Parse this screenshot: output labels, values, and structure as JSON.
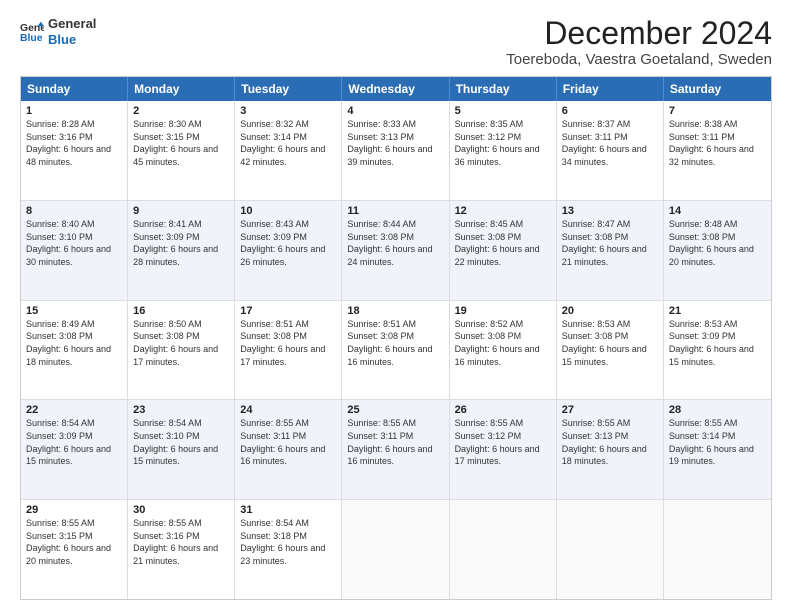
{
  "logo": {
    "line1": "General",
    "line2": "Blue"
  },
  "title": "December 2024",
  "subtitle": "Toereboda, Vaestra Goetaland, Sweden",
  "header_days": [
    "Sunday",
    "Monday",
    "Tuesday",
    "Wednesday",
    "Thursday",
    "Friday",
    "Saturday"
  ],
  "weeks": [
    {
      "alt": false,
      "days": [
        {
          "num": "1",
          "sunrise": "8:28 AM",
          "sunset": "3:16 PM",
          "daylight": "6 hours and 48 minutes."
        },
        {
          "num": "2",
          "sunrise": "8:30 AM",
          "sunset": "3:15 PM",
          "daylight": "6 hours and 45 minutes."
        },
        {
          "num": "3",
          "sunrise": "8:32 AM",
          "sunset": "3:14 PM",
          "daylight": "6 hours and 42 minutes."
        },
        {
          "num": "4",
          "sunrise": "8:33 AM",
          "sunset": "3:13 PM",
          "daylight": "6 hours and 39 minutes."
        },
        {
          "num": "5",
          "sunrise": "8:35 AM",
          "sunset": "3:12 PM",
          "daylight": "6 hours and 36 minutes."
        },
        {
          "num": "6",
          "sunrise": "8:37 AM",
          "sunset": "3:11 PM",
          "daylight": "6 hours and 34 minutes."
        },
        {
          "num": "7",
          "sunrise": "8:38 AM",
          "sunset": "3:11 PM",
          "daylight": "6 hours and 32 minutes."
        }
      ]
    },
    {
      "alt": true,
      "days": [
        {
          "num": "8",
          "sunrise": "8:40 AM",
          "sunset": "3:10 PM",
          "daylight": "6 hours and 30 minutes."
        },
        {
          "num": "9",
          "sunrise": "8:41 AM",
          "sunset": "3:09 PM",
          "daylight": "6 hours and 28 minutes."
        },
        {
          "num": "10",
          "sunrise": "8:43 AM",
          "sunset": "3:09 PM",
          "daylight": "6 hours and 26 minutes."
        },
        {
          "num": "11",
          "sunrise": "8:44 AM",
          "sunset": "3:08 PM",
          "daylight": "6 hours and 24 minutes."
        },
        {
          "num": "12",
          "sunrise": "8:45 AM",
          "sunset": "3:08 PM",
          "daylight": "6 hours and 22 minutes."
        },
        {
          "num": "13",
          "sunrise": "8:47 AM",
          "sunset": "3:08 PM",
          "daylight": "6 hours and 21 minutes."
        },
        {
          "num": "14",
          "sunrise": "8:48 AM",
          "sunset": "3:08 PM",
          "daylight": "6 hours and 20 minutes."
        }
      ]
    },
    {
      "alt": false,
      "days": [
        {
          "num": "15",
          "sunrise": "8:49 AM",
          "sunset": "3:08 PM",
          "daylight": "6 hours and 18 minutes."
        },
        {
          "num": "16",
          "sunrise": "8:50 AM",
          "sunset": "3:08 PM",
          "daylight": "6 hours and 17 minutes."
        },
        {
          "num": "17",
          "sunrise": "8:51 AM",
          "sunset": "3:08 PM",
          "daylight": "6 hours and 17 minutes."
        },
        {
          "num": "18",
          "sunrise": "8:51 AM",
          "sunset": "3:08 PM",
          "daylight": "6 hours and 16 minutes."
        },
        {
          "num": "19",
          "sunrise": "8:52 AM",
          "sunset": "3:08 PM",
          "daylight": "6 hours and 16 minutes."
        },
        {
          "num": "20",
          "sunrise": "8:53 AM",
          "sunset": "3:08 PM",
          "daylight": "6 hours and 15 minutes."
        },
        {
          "num": "21",
          "sunrise": "8:53 AM",
          "sunset": "3:09 PM",
          "daylight": "6 hours and 15 minutes."
        }
      ]
    },
    {
      "alt": true,
      "days": [
        {
          "num": "22",
          "sunrise": "8:54 AM",
          "sunset": "3:09 PM",
          "daylight": "6 hours and 15 minutes."
        },
        {
          "num": "23",
          "sunrise": "8:54 AM",
          "sunset": "3:10 PM",
          "daylight": "6 hours and 15 minutes."
        },
        {
          "num": "24",
          "sunrise": "8:55 AM",
          "sunset": "3:11 PM",
          "daylight": "6 hours and 16 minutes."
        },
        {
          "num": "25",
          "sunrise": "8:55 AM",
          "sunset": "3:11 PM",
          "daylight": "6 hours and 16 minutes."
        },
        {
          "num": "26",
          "sunrise": "8:55 AM",
          "sunset": "3:12 PM",
          "daylight": "6 hours and 17 minutes."
        },
        {
          "num": "27",
          "sunrise": "8:55 AM",
          "sunset": "3:13 PM",
          "daylight": "6 hours and 18 minutes."
        },
        {
          "num": "28",
          "sunrise": "8:55 AM",
          "sunset": "3:14 PM",
          "daylight": "6 hours and 19 minutes."
        }
      ]
    },
    {
      "alt": false,
      "days": [
        {
          "num": "29",
          "sunrise": "8:55 AM",
          "sunset": "3:15 PM",
          "daylight": "6 hours and 20 minutes."
        },
        {
          "num": "30",
          "sunrise": "8:55 AM",
          "sunset": "3:16 PM",
          "daylight": "6 hours and 21 minutes."
        },
        {
          "num": "31",
          "sunrise": "8:54 AM",
          "sunset": "3:18 PM",
          "daylight": "6 hours and 23 minutes."
        },
        {
          "num": "",
          "sunrise": "",
          "sunset": "",
          "daylight": ""
        },
        {
          "num": "",
          "sunrise": "",
          "sunset": "",
          "daylight": ""
        },
        {
          "num": "",
          "sunrise": "",
          "sunset": "",
          "daylight": ""
        },
        {
          "num": "",
          "sunrise": "",
          "sunset": "",
          "daylight": ""
        }
      ]
    }
  ]
}
